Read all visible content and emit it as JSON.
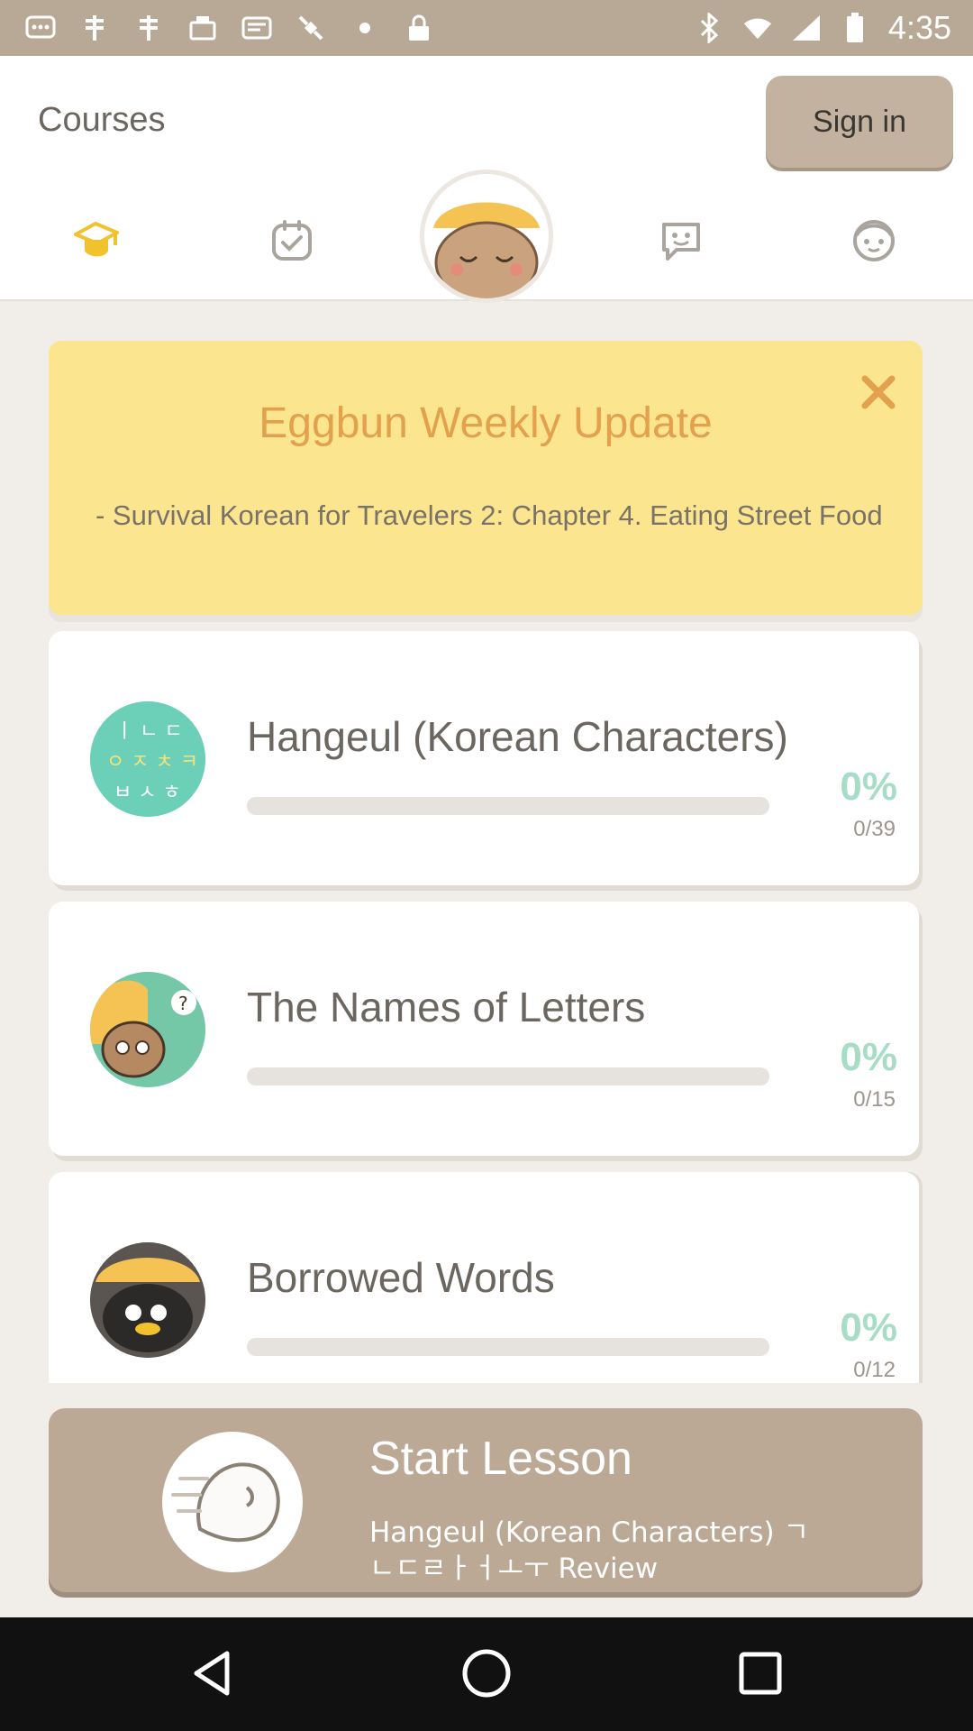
{
  "status_bar": {
    "time": "4:35",
    "icons": [
      "message-icon",
      "grid-icon",
      "grid-icon",
      "fax-icon",
      "message-icon",
      "satellite-icon",
      "dot-icon",
      "lock-icon"
    ]
  },
  "header": {
    "title": "Courses",
    "sign_in_label": "Sign in",
    "tabs": [
      {
        "name": "courses-tab",
        "icon": "grad-cap-icon",
        "active": true
      },
      {
        "name": "checklist-tab",
        "icon": "checklist-icon",
        "active": false
      },
      {
        "name": "eggbun-tab",
        "icon": "eggbun-face-icon",
        "active": false
      },
      {
        "name": "chat-tab",
        "icon": "chat-bubble-icon",
        "active": false
      },
      {
        "name": "profile-tab",
        "icon": "profile-face-icon",
        "active": false
      }
    ]
  },
  "update": {
    "title": "Eggbun Weekly Update",
    "body": "- Survival Korean for Travelers 2: Chapter 4. Eating Street Food"
  },
  "courses": [
    {
      "title": "Hangeul (Korean Characters)",
      "percent": "0%",
      "count": "0/39",
      "progress": 0
    },
    {
      "title": "The Names of Letters",
      "percent": "0%",
      "count": "0/15",
      "progress": 0
    },
    {
      "title": "Borrowed Words",
      "percent": "0%",
      "count": "0/12",
      "progress": 0
    }
  ],
  "start_lesson": {
    "title": "Start Lesson",
    "subtitle": "Hangeul (Korean Characters) ㄱ ㄴㄷㄹㅏㅓㅗㅜ Review"
  },
  "colors": {
    "accent": "#e3a04d",
    "header_button": "#c2b29f",
    "update_bg": "#fbe58f",
    "percent": "#a7dcc7",
    "start_bg": "#bba995"
  }
}
